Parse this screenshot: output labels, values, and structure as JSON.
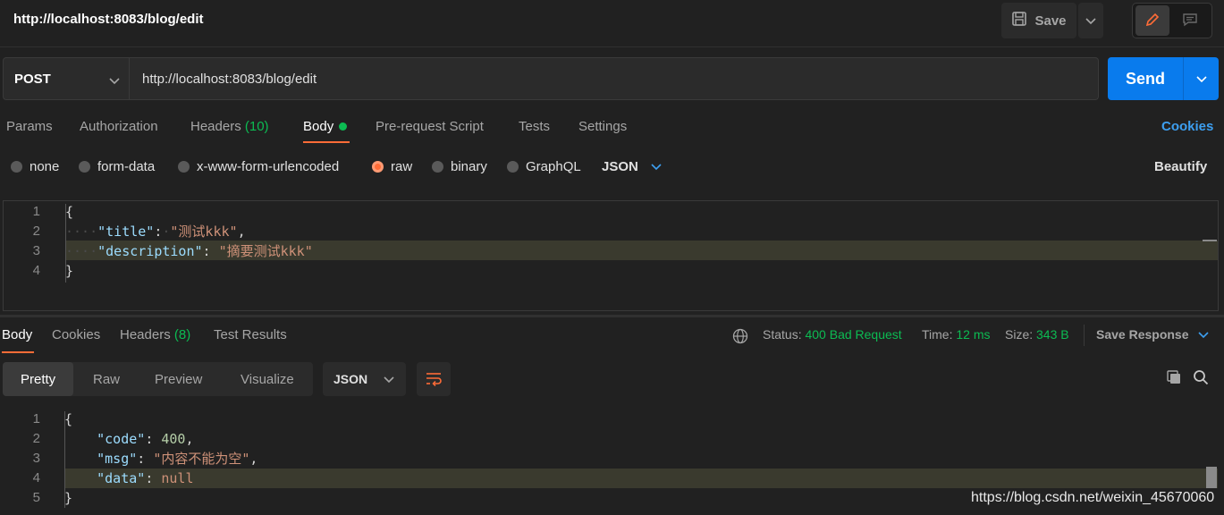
{
  "header": {
    "title": "http://localhost:8083/blog/edit",
    "save_label": "Save"
  },
  "request": {
    "method": "POST",
    "url": "http://localhost:8083/blog/edit",
    "send_label": "Send"
  },
  "request_tabs": {
    "params": "Params",
    "authorization": "Authorization",
    "headers": "Headers",
    "headers_count": "(10)",
    "body": "Body",
    "prerequest": "Pre-request Script",
    "tests": "Tests",
    "settings": "Settings",
    "cookies": "Cookies"
  },
  "body_types": {
    "none": "none",
    "form_data": "form-data",
    "urlencoded": "x-www-form-urlencoded",
    "raw": "raw",
    "binary": "binary",
    "graphql": "GraphQL",
    "format": "JSON",
    "beautify": "Beautify",
    "selected": "raw"
  },
  "request_body": {
    "line_numbers": [
      "1",
      "2",
      "3",
      "4"
    ],
    "open_brace": "{",
    "close_brace": "}",
    "title_key": "\"title\"",
    "title_value": "\"测试kkk\"",
    "description_key": "\"description\"",
    "description_value": "\"摘要测试kkk\""
  },
  "response_tabs": {
    "body": "Body",
    "cookies": "Cookies",
    "headers": "Headers",
    "headers_count": "(8)",
    "test_results": "Test Results"
  },
  "response_meta": {
    "status_label": "Status:",
    "status_value": "400 Bad Request",
    "time_label": "Time:",
    "time_value": "12 ms",
    "size_label": "Size:",
    "size_value": "343 B",
    "save_response": "Save Response"
  },
  "response_view": {
    "pretty": "Pretty",
    "raw": "Raw",
    "preview": "Preview",
    "visualize": "Visualize",
    "format": "JSON"
  },
  "response_body": {
    "line_numbers": [
      "1",
      "2",
      "3",
      "4",
      "5"
    ],
    "open_brace": "{",
    "close_brace": "}",
    "code_key": "\"code\"",
    "code_value": "400",
    "msg_key": "\"msg\"",
    "msg_value": "\"内容不能为空\"",
    "data_key": "\"data\"",
    "data_value": "null"
  },
  "watermark": "https://blog.csdn.net/weixin_45670060",
  "colors": {
    "accent": "#ff6c37",
    "send": "#097bed",
    "link": "#3d9ff0",
    "status_green": "#0cbb52"
  }
}
